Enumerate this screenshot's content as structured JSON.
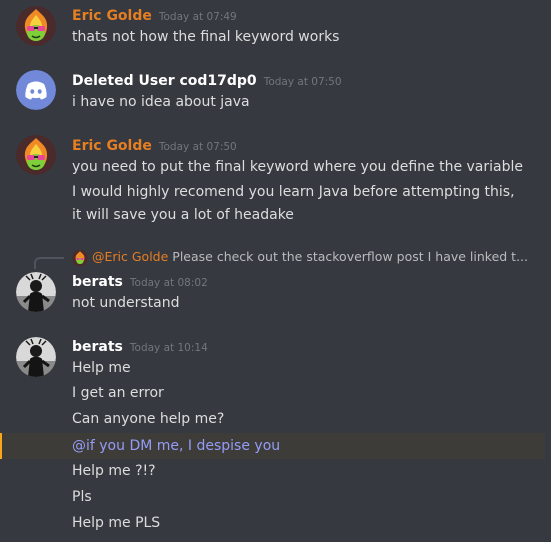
{
  "colors": {
    "background": "#36393f",
    "eric": "#e67e22",
    "deleted": "#ffffff",
    "berats": "#ffffff",
    "mention_text": "#949cf7",
    "mention_highlight": "#faa61a"
  },
  "messages": [
    {
      "username": "Eric Golde",
      "timestamp": "Today at 07:49",
      "avatar_icon": "fire-creature-avatar-icon",
      "lines": [
        "thats not how the final keyword works"
      ]
    },
    {
      "username": "Deleted User cod17dp0",
      "timestamp": "Today at 07:50",
      "avatar_icon": "discord-logo-icon",
      "lines": [
        "i have no idea about java"
      ]
    },
    {
      "username": "Eric Golde",
      "timestamp": "Today at 07:50",
      "avatar_icon": "fire-creature-avatar-icon",
      "lines": [
        "you need to put the final keyword where you define the variable",
        "I would highly recomend you learn Java before attempting this,",
        "it will save you a lot of headake"
      ]
    },
    {
      "reply": {
        "mention": "@Eric Golde",
        "text": "Please check out the stackoverflow post I have linked t..."
      },
      "username": "berats",
      "timestamp": "Today at 08:02",
      "avatar_icon": "figure-avatar-icon",
      "lines": [
        "not understand"
      ]
    },
    {
      "username": "berats",
      "timestamp": "Today at 10:14",
      "avatar_icon": "figure-avatar-icon",
      "lines": [
        "Help me",
        "I get an error",
        "Can anyone help me?",
        "@if you DM me, I despise you",
        "Help me ?!?",
        "Pls",
        "Help me PLS"
      ]
    }
  ]
}
